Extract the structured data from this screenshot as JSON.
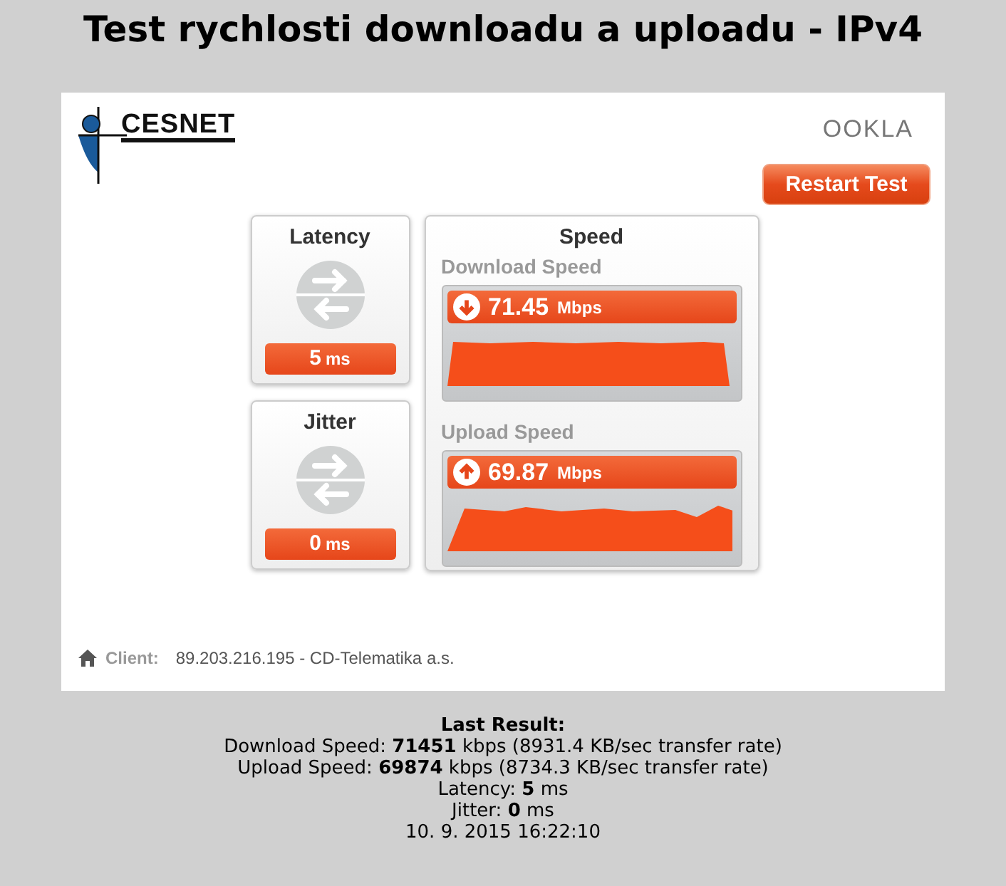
{
  "title": "Test rychlosti downloadu a uploadu - IPv4",
  "widget": {
    "logo_left": "CESNET",
    "logo_right": "OOKLA",
    "restart_button": "Restart Test",
    "latency": {
      "label": "Latency",
      "value": "5",
      "unit": "ms"
    },
    "jitter": {
      "label": "Jitter",
      "value": "0",
      "unit": "ms"
    },
    "speed": {
      "title": "Speed",
      "meters": [
        {
          "kind": "download",
          "label": "Download Speed",
          "value": "71.45",
          "unit": "Mbps"
        },
        {
          "kind": "upload",
          "label": "Upload Speed",
          "value": "69.87",
          "unit": "Mbps"
        }
      ]
    },
    "client": {
      "label": "Client:",
      "value": "89.203.216.195 - CD-Telematika a.s."
    }
  },
  "last_result": {
    "heading": "Last Result:",
    "lines": [
      "Download Speed: **71451** kbps (8931.4 KB/sec transfer rate)",
      "Upload Speed: **69874** kbps (8734.3 KB/sec transfer rate)",
      "Latency: **5** ms",
      "Jitter: **0** ms",
      "10. 9. 2015 16:22:10"
    ]
  }
}
